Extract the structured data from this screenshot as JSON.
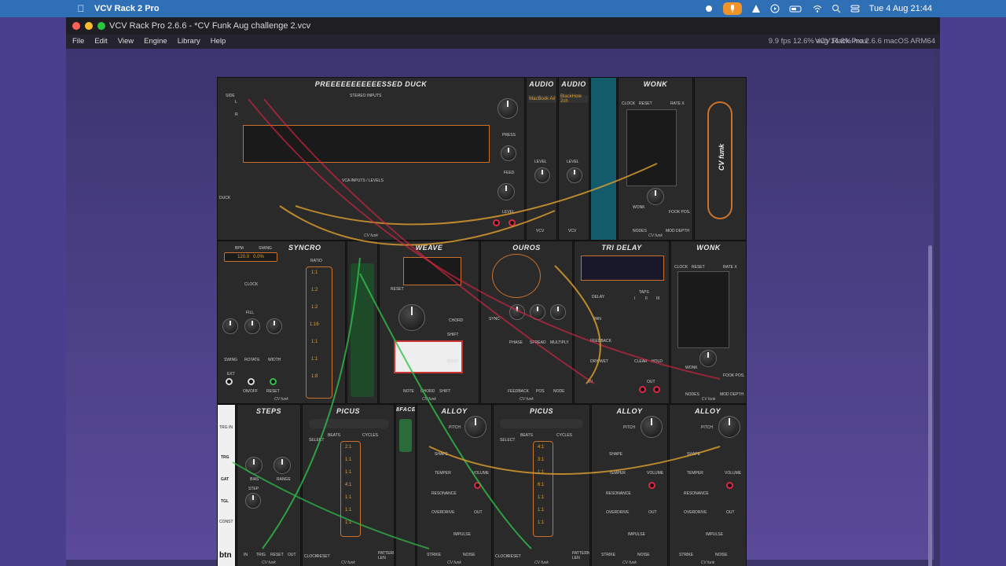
{
  "menubar": {
    "app_name": "VCV Rack 2 Pro",
    "clock": "Tue 4 Aug  21:44",
    "icons": [
      "apple-icon",
      "record-icon",
      "mic-icon",
      "accessibility-icon",
      "play-icon",
      "battery-icon",
      "wifi-icon",
      "search-icon",
      "control-center-icon"
    ]
  },
  "window": {
    "title": "VCV Rack Pro 2.6.6 - *CV Funk Aug challenge 2.vcv",
    "menu": [
      "File",
      "Edit",
      "View",
      "Engine",
      "Library",
      "Help"
    ],
    "stats": "9.9 fps  12.6% avg  14.8% max",
    "version": "VCV Rack Pro 2.6.6 macOS ARM64"
  },
  "modules": {
    "duck": {
      "title": "PREEEEEEEEEEESSED DUCK",
      "side": "SIDE",
      "stereo": "STEREO INPUTS",
      "vca": "VCA INPUTS / LEVELS",
      "press": "PRESS",
      "feed": "FEED",
      "level": "LEVEL",
      "duck": "DUCK",
      "l": "L",
      "r": "R",
      "footer": "CV funk"
    },
    "audio1": {
      "title": "AUDIO",
      "device": "MacBook Air",
      "level": "LEVEL",
      "brand": "VCV"
    },
    "audio2": {
      "title": "AUDIO",
      "device": "BlackHole 2ch",
      "level": "LEVEL",
      "brand": "VCV"
    },
    "wonk1": {
      "title": "WONK",
      "clock": "CLOCK",
      "reset": "RESET",
      "rate": "RATE X",
      "wonk": "WONK",
      "nodes": "NODES",
      "mod_depth": "MOD DEPTH",
      "fook": "FOOK POS.",
      "footer": "CV funk"
    },
    "cvfunk_blank": {
      "label": "CV funk"
    },
    "syncro": {
      "title": "SYNCRO",
      "bpm": "BPM",
      "swing": "SWING",
      "bpm_val": "120.0",
      "swing_val": "0.0%",
      "clock": "CLOCK",
      "fill": "FILL",
      "ratio": "RATIO",
      "ratios": [
        "1:1",
        "1:2",
        "1:2",
        "1:16",
        "1:1",
        "1:1",
        "1:8"
      ],
      "rotate": "ROTATE",
      "width": "WIDTH",
      "ext": "EXT",
      "on_off": "ON/OFF",
      "reset": "RESET",
      "footer": "CV funk"
    },
    "weave": {
      "title": "WEAVE",
      "chord": "CHORD",
      "shift": "SHIFT",
      "root": "ROOT",
      "note": "NOTE",
      "reset": "RESET",
      "footer": "CV funk"
    },
    "ouros": {
      "title": "OUROS",
      "sync": "SYNC",
      "phase": "PHASE",
      "spread": "SPREAD",
      "multiply": "MULTIPLY",
      "feedback": "FEEDBACK",
      "pos": "POS",
      "node": "NODE",
      "footer": "CV funk"
    },
    "tridelay": {
      "title": "TRI DELAY",
      "delay": "DELAY",
      "taps": "TAPS",
      "tap_labels": [
        "I",
        "II",
        "III"
      ],
      "pan": "PAN",
      "feedback": "FEEDBACK",
      "drywet": "DRY/WET",
      "clear": "CLEAR",
      "hold": "HOLD",
      "in": "IN",
      "out": "OUT"
    },
    "wonk2": {
      "title": "WONK",
      "clock": "CLOCK",
      "reset": "RESET",
      "rate": "RATE X",
      "wonk": "WONK",
      "nodes": "NODES",
      "mod_depth": "MOD DEPTH",
      "fook": "FOOK POS.",
      "footer": "CV funk"
    },
    "btn": {
      "label": "btn",
      "trg": "TRG",
      "gat": "GAT",
      "tgl": "TGL",
      "const": "CONST",
      "trg_in": "TRG IN"
    },
    "steps": {
      "title": "STEPS",
      "bias": "BIAS",
      "range": "RANGE",
      "step": "STEP",
      "out": "OUT",
      "in": "IN",
      "trig": "TRIG",
      "reset": "RESET",
      "footer": "CV funk"
    },
    "picus1": {
      "title": "PICUS",
      "select": "SELECT",
      "beats": "BEATS",
      "cycles": "CYCLES",
      "ratios": [
        "2:1",
        "1:1",
        "1:1",
        "4:1",
        "1:1",
        "1:1",
        "1:1"
      ],
      "clock": "CLOCK",
      "reset": "RESET",
      "pattern": "PATTERN LEN",
      "footer": "CV funk"
    },
    "bface": {
      "title": "8FACE"
    },
    "alloy1": {
      "title": "ALLOY",
      "pitch": "PITCH",
      "shape": "SHAPE",
      "temper": "TEMPER",
      "volume": "VOLUME",
      "resonance": "RESONANCE",
      "overdrive": "OVERDRIVE",
      "impulse": "IMPULSE",
      "strike": "STRIKE",
      "noise": "NOISE",
      "out": "OUT",
      "footer": "CV funk"
    },
    "picus2": {
      "title": "PICUS",
      "select": "SELECT",
      "beats": "BEATS",
      "cycles": "CYCLES",
      "ratios": [
        "4:1",
        "3:1",
        "1:1",
        "6:1",
        "1:1",
        "1:1",
        "1:1"
      ],
      "clock": "CLOCK",
      "reset": "RESET",
      "pattern": "PATTERN LEN",
      "footer": "CV funk"
    },
    "alloy2": {
      "title": "ALLOY",
      "pitch": "PITCH",
      "shape": "SHAPE",
      "temper": "TEMPER",
      "volume": "VOLUME",
      "resonance": "RESONANCE",
      "overdrive": "OVERDRIVE",
      "impulse": "IMPULSE",
      "strike": "STRIKE",
      "noise": "NOISE",
      "out": "OUT",
      "footer": "CV funk"
    },
    "alloy3": {
      "title": "ALLOY",
      "pitch": "PITCH",
      "shape": "SHAPE",
      "temper": "TEMPER",
      "volume": "VOLUME",
      "resonance": "RESONANCE",
      "overdrive": "OVERDRIVE",
      "impulse": "IMPULSE",
      "strike": "STRIKE",
      "noise": "NOISE",
      "out": "OUT",
      "footer": "CV funk"
    }
  },
  "colors": {
    "cable_red": "#e02744",
    "cable_yellow": "#e0a030",
    "cable_green": "#2fbf4a",
    "accent_orange": "#c8712e",
    "menubar_blue": "#2f6fb5"
  }
}
